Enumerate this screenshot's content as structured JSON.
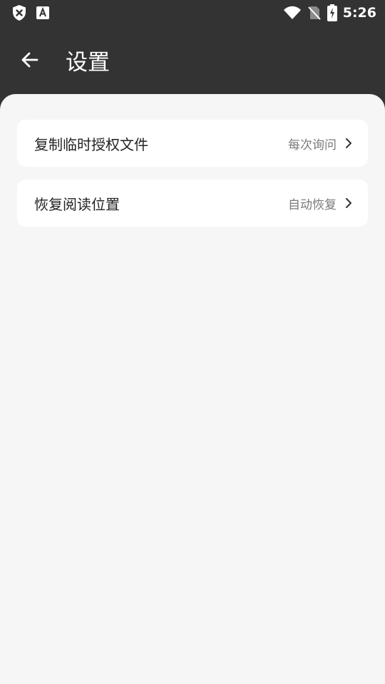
{
  "status_bar": {
    "time": "5:26",
    "icons": [
      "shield-x-icon",
      "font-a-icon",
      "wifi-icon",
      "no-sim-icon",
      "battery-charging-icon"
    ]
  },
  "app_bar": {
    "back_icon": "arrow-left-icon",
    "title": "设置"
  },
  "settings": [
    {
      "label": "复制临时授权文件",
      "value": "每次询问",
      "icon": "chevron-right-icon"
    },
    {
      "label": "恢复阅读位置",
      "value": "自动恢复",
      "icon": "chevron-right-icon"
    }
  ],
  "colors": {
    "header_bg": "#333333",
    "content_bg": "#f6f6f6",
    "card_bg": "#ffffff",
    "value_text": "#7a7a7a"
  }
}
